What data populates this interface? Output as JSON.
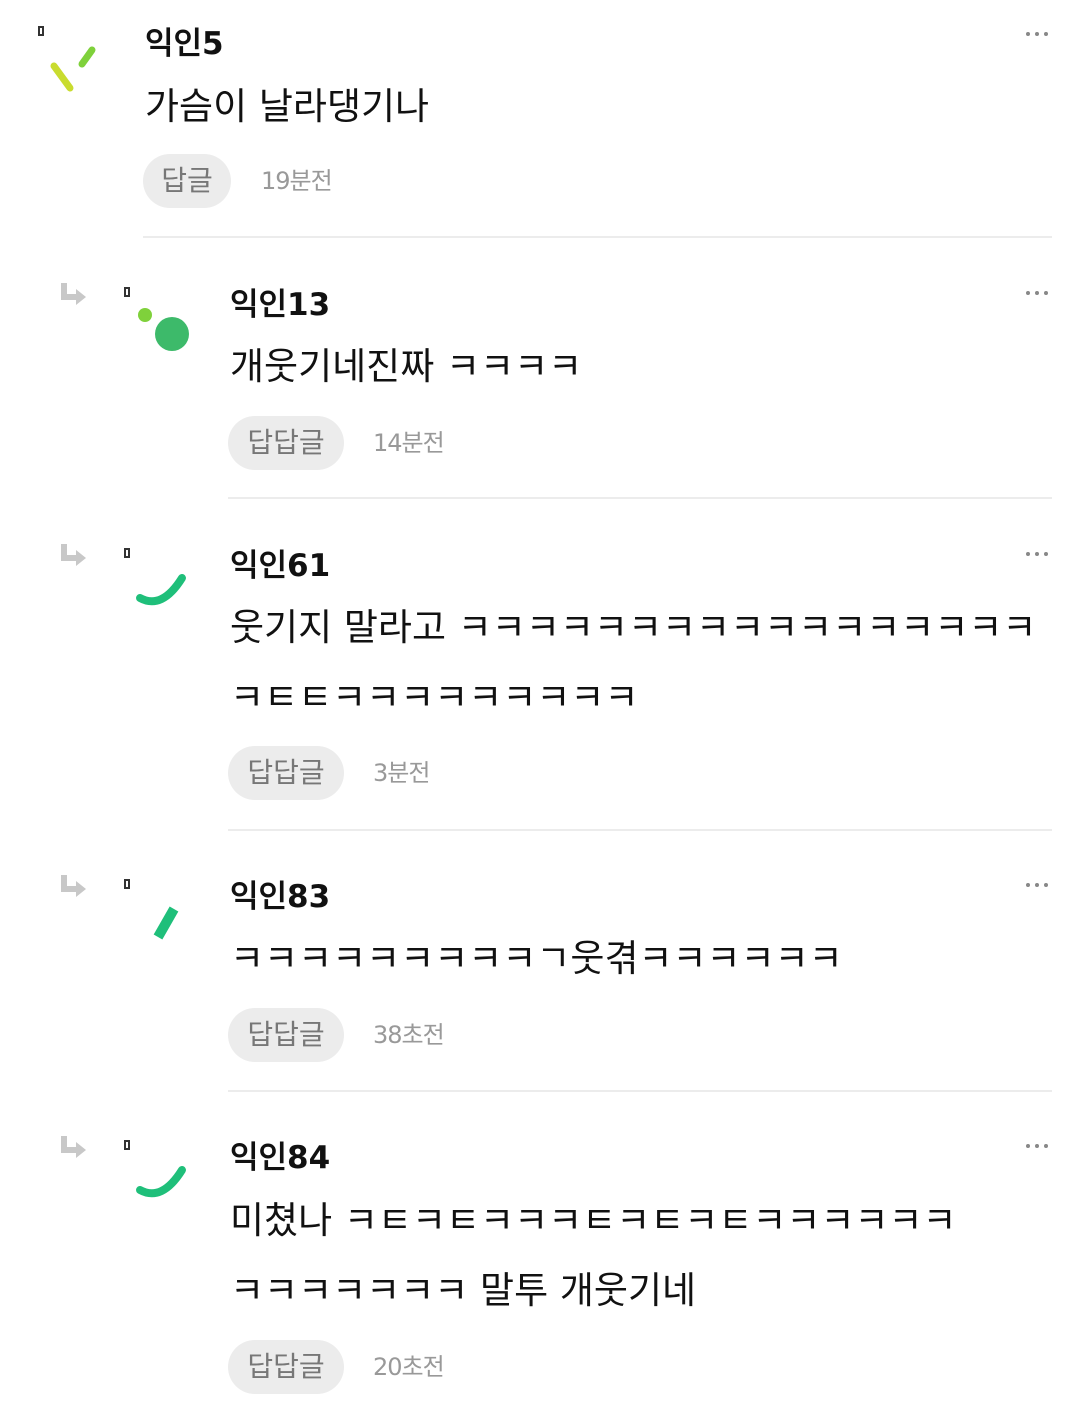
{
  "comments": [
    {
      "nickname": "익인5",
      "body": [
        "가슴이 날라댕기나"
      ],
      "reply_label": "답글",
      "time": "19분전"
    },
    {
      "nickname": "익인13",
      "body": [
        "개웃기네진짜 ㅋㅋㅋㅋ"
      ],
      "reply_label": "답답글",
      "time": "14분전"
    },
    {
      "nickname": "익인61",
      "body": [
        "웃기지 말라고 ㅋㅋㅋㅋㅋㅋㅋㅋㅋㅋㅋㅋㅋㅋㅋㅋㅋ",
        "ㅋㅌㅌㅋㅋㅋㅋㅋㅋㅋㅋㅋ"
      ],
      "reply_label": "답답글",
      "time": "3분전"
    },
    {
      "nickname": "익인83",
      "body": [
        "ㅋㅋㅋㅋㅋㅋㅋㅋㅋㄱ웃겪ㅋㅋㅋㅋㅋㅋ"
      ],
      "reply_label": "답답글",
      "time": "38초전"
    },
    {
      "nickname": "익인84",
      "body": [
        "미쳤나 ㅋㅌㅋㅌㅋㅋㅋㅌㅋㅌㅋㅌㅋㅋㅋㅋㅋㅋ",
        "ㅋㅋㅋㅋㅋㅋㅋ 말투 개웃기네"
      ],
      "reply_label": "답답글",
      "time": "20초전"
    }
  ],
  "icons": {
    "reply_arrow": "reply-arrow-icon",
    "more": "more-options-icon",
    "avatar_colors": [
      "#c9dc2f",
      "#7fd13b",
      "#1fbf7a"
    ],
    "arrow_color": "#c8c8c8"
  }
}
